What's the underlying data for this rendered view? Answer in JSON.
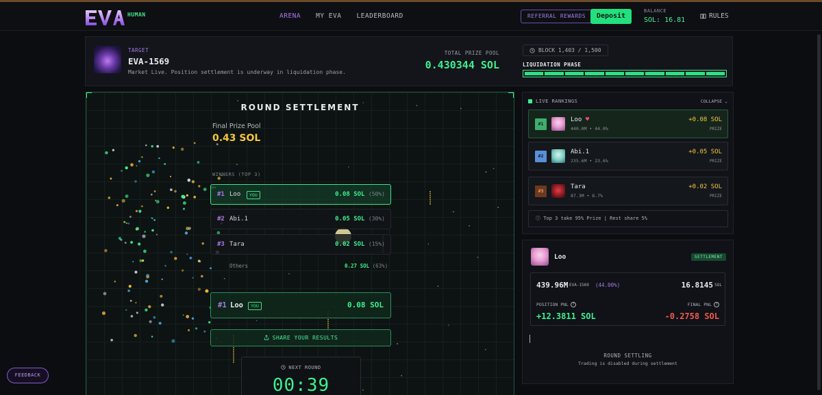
{
  "nav": {
    "logo_text": "EVA",
    "logo_sub": "HUMAN",
    "links": [
      {
        "label": "ARENA",
        "active": true
      },
      {
        "label": "MY EVA",
        "active": false
      },
      {
        "label": "LEADERBOARD",
        "active": false
      }
    ],
    "referral_label": "REFERRAL REWARDS",
    "deposit_label": "Deposit",
    "balance_label": "BALANCE",
    "balance_value": "SOL: 16.81",
    "rules_label": "RULES"
  },
  "target": {
    "label": "TARGET",
    "name": "EVA-1569",
    "description": "Market Live. Position settlement is underway in liquidation phase.",
    "pool_label": "TOTAL PRIZE POOL",
    "pool_value": "0.430344 SOL",
    "block": "BLOCK 1,403 / 1,500",
    "phase_label": "LIQUIDATION PHASE",
    "phase_progress": 1.0
  },
  "settlement": {
    "title": "ROUND SETTLEMENT",
    "final_pool_label": "Final Prize Pool",
    "final_pool_value": "0.43 SOL",
    "winners_label": "WINNERS (TOP 3)",
    "winners": [
      {
        "rank": "#1",
        "name": "Loo",
        "you": "YOU",
        "amount": "0.08 SOL",
        "share": "(50%)"
      },
      {
        "rank": "#2",
        "name": "Abi.1",
        "you": "",
        "amount": "0.05 SOL",
        "share": "(30%)"
      },
      {
        "rank": "#3",
        "name": "Tara",
        "you": "",
        "amount": "0.02 SOL",
        "share": "(15%)"
      }
    ],
    "others_label": "Others",
    "others_amount": "0.27 SOL",
    "others_share": "(63%)",
    "my_rank": "#1",
    "my_name": "Loo",
    "my_you": "YOU",
    "my_amount": "0.08 SOL",
    "share_label": "SHARE YOUR RESULTS",
    "next_round_label": "NEXT ROUND",
    "next_round_time": "00:39"
  },
  "rankings": {
    "title": "LIVE RANKINGS",
    "collapse_label": "COLLAPSE",
    "entries": [
      {
        "rank": "#1",
        "name": "Loo",
        "stats": "440.0M • 44.0%",
        "sol": "+0.08 SOL",
        "prize": "PRIZE"
      },
      {
        "rank": "#2",
        "name": "Abi.1",
        "stats": "235.6M • 23.6%",
        "sol": "+0.05 SOL",
        "prize": "PRIZE"
      },
      {
        "rank": "#3",
        "name": "Tara",
        "stats": "87.3M • 8.7%",
        "sol": "+0.02 SOL",
        "prize": "PRIZE"
      }
    ],
    "footer": "Top 3 take 95% Prize | Rest share 5%"
  },
  "position": {
    "name": "Loo",
    "badge": "SETTLEMENT",
    "quantity": "439.96M",
    "ticker": "EVA-1569",
    "pct": "(44.00%)",
    "value": "16.8145",
    "value_unit": "SOL",
    "pnl_label": "POSITION PNL",
    "pnl_value": "+12.3811 SOL",
    "final_pnl_label": "FINAL PNL",
    "final_pnl_value": "-0.2758 SOL",
    "settling_label": "ROUND SETTLING",
    "disabled_text": "Trading is disabled during settlement"
  },
  "feedback_label": "FEEDBACK",
  "colors": {
    "accent_green": "#3df08f",
    "accent_purple": "#a77ae6",
    "gold": "#f4c63d",
    "loss_red": "#f05a4c"
  }
}
